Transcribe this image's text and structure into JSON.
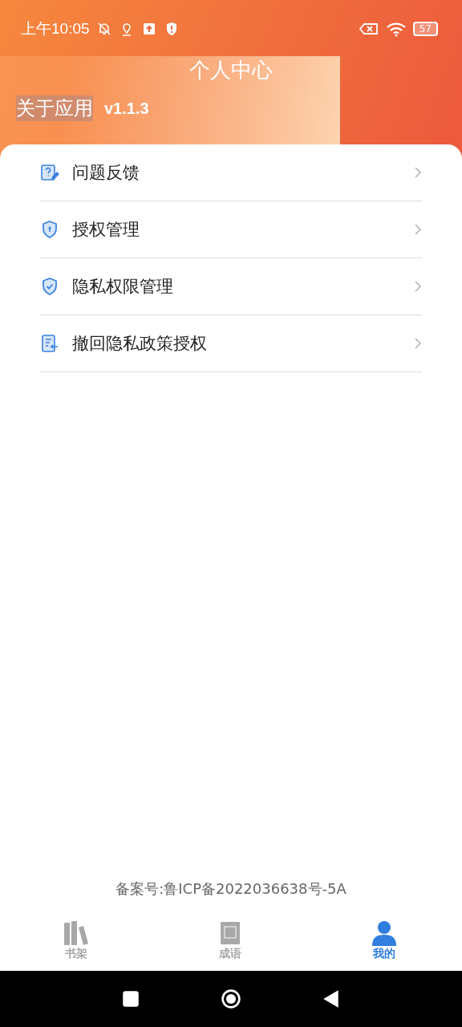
{
  "status_bar": {
    "time": "上午10:05",
    "battery": "57"
  },
  "header": {
    "title": "个人中心",
    "about_label": "关于应用",
    "version": "v1.1.3"
  },
  "menu": [
    {
      "kind": "feedback",
      "label": "问题反馈"
    },
    {
      "kind": "auth",
      "label": "授权管理"
    },
    {
      "kind": "privacy",
      "label": "隐私权限管理"
    },
    {
      "kind": "revoke",
      "label": "撤回隐私政策授权"
    }
  ],
  "footer": {
    "icp": "备案号:鲁ICP备2022036638号-5A"
  },
  "tabs": [
    {
      "kind": "shelf",
      "label": "书架",
      "selected": false
    },
    {
      "kind": "idiom",
      "label": "成语",
      "selected": false
    },
    {
      "kind": "me",
      "label": "我的",
      "selected": true
    }
  ]
}
